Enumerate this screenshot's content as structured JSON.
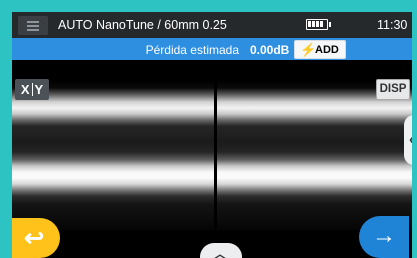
{
  "titlebar": {
    "title": "AUTO NanoTune / 60mm 0.25",
    "clock": "11:30",
    "menu_icon": "hamburger-menu-icon",
    "battery_icon": "battery-full-icon"
  },
  "lossbar": {
    "label": "Pérdida estimada",
    "value": "0.00dB",
    "add_label": "ADD",
    "add_icon": "lightning-bolt-icon"
  },
  "view": {
    "xy_label_x": "X",
    "xy_label_y": "Y",
    "disp_label": "DISP",
    "side_tab_icon": "chevron-left-icon",
    "up_tab_icon": "chevron-up-icon"
  },
  "nav": {
    "back_icon": "return-arrow-icon",
    "next_icon": "right-arrow-icon"
  },
  "colors": {
    "device_frame": "#2ec3c3",
    "titlebar": "#26292c",
    "lossbar": "#2e8fe0",
    "back_button": "#ffc21a",
    "next_button": "#1f84d6"
  }
}
